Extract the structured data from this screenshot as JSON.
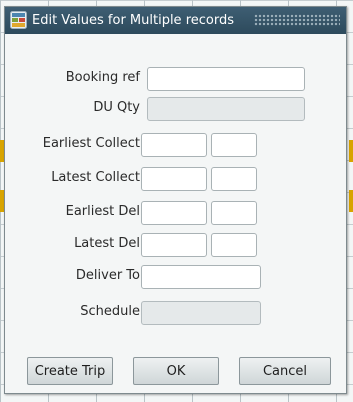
{
  "dialog": {
    "title": "Edit Values for Multiple records",
    "icon": "app-window-icon"
  },
  "fields": [
    {
      "label": "Booking ref",
      "value": "",
      "readonly": false
    },
    {
      "label": "DU Qty",
      "value": "",
      "readonly": true
    },
    {
      "label": "Earliest Collect",
      "date": "",
      "time": ""
    },
    {
      "label": "Latest Collect",
      "date": "",
      "time": ""
    },
    {
      "label": "Earliest Del",
      "date": "",
      "time": ""
    },
    {
      "label": "Latest Del",
      "date": "",
      "time": ""
    },
    {
      "label": "Deliver To",
      "value": "",
      "readonly": false
    },
    {
      "label": "Schedule",
      "value": "",
      "readonly": true
    }
  ],
  "buttons": {
    "create_trip": "Create Trip",
    "ok": "OK",
    "cancel": "Cancel"
  },
  "colors": {
    "titlebar": "#34546a",
    "dialog_bg": "#f4f6f6",
    "readonly_field": "#e5e9ea",
    "background_marker": "#d8a400"
  }
}
